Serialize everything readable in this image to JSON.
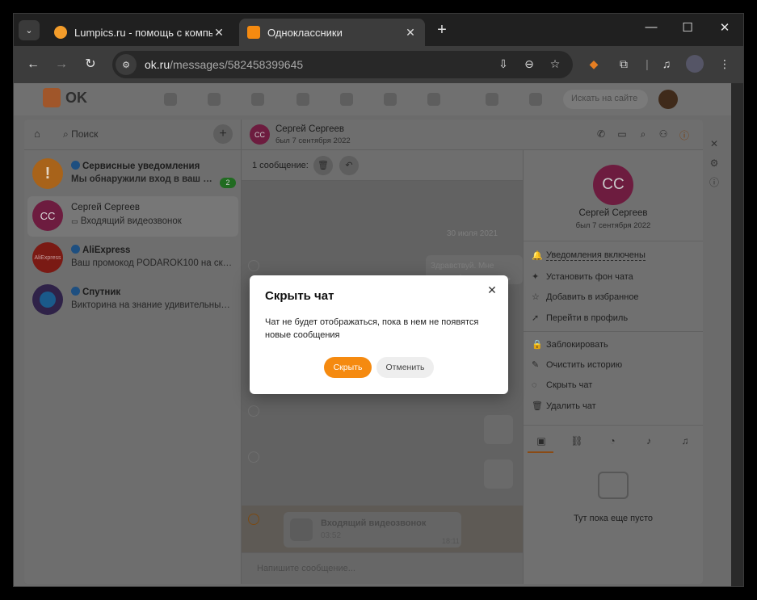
{
  "browser": {
    "tabs": [
      {
        "title": "Lumpics.ru - помощь с компьютером",
        "close": "✕",
        "favicon_color": "#f39c2a"
      },
      {
        "title": "Одноклассники",
        "close": "✕",
        "favicon_color": "#f58a10"
      }
    ],
    "new_tab": "+",
    "tab_menu": "⌄",
    "window_controls": {
      "minimize": "—",
      "maximize": "☐",
      "close": "✕"
    },
    "nav": {
      "back": "←",
      "forward": "→",
      "reload": "↻"
    },
    "url_host": "ok.ru",
    "url_path": "/messages/582458399645"
  },
  "ok": {
    "logo_text": "OK",
    "search_placeholder": "Искать на сайте"
  },
  "sidebar": {
    "home_icon": "⌂",
    "search_label": "Поиск",
    "add_icon": "+",
    "chats": [
      {
        "name": "Сервисные уведомления",
        "preview": "Мы обнаружили вход в ваш профиль",
        "unread": "2",
        "avatar_text": "!",
        "avatar_color": "#a8631a",
        "bold": true,
        "verified": true
      },
      {
        "name": "Сергей Сергеев",
        "preview": "Входящий видеозвонок",
        "preview_icon": "▭",
        "avatar_text": "СС",
        "avatar_color": "#6d1c3f",
        "bold": false,
        "verified": false,
        "selected": true
      },
      {
        "name": "AliExpress",
        "preview": "Ваш промокод PODAROK100 на скидку",
        "avatar_text": "AliExpress",
        "avatar_color": "#7a1a14",
        "bold": false,
        "verified": true
      },
      {
        "name": "Спутник",
        "preview": "Викторина на знание удивительных фактов",
        "avatar_text": "",
        "avatar_color": "#2f2248",
        "bold": false,
        "verified": true
      }
    ]
  },
  "chat": {
    "avatar_text": "СС",
    "name": "Сергей Сергеев",
    "status": "был 7 сентября 2022",
    "selection_text": "1 сообщение:",
    "date_chip": "30 июля 2021",
    "ghost_message": "Здравствуй. Мне нужны фото, отправь их мне, пожалуйста",
    "call_title": "Входящий видеозвонок",
    "call_duration": "03:52",
    "call_time": "18:11",
    "composer_placeholder": "Напишите сообщение..."
  },
  "info": {
    "avatar_text": "СС",
    "name": "Сергей Сергеев",
    "status": "был 7 сентября 2022",
    "items_group1": [
      {
        "icon": "🔔",
        "label": "Уведомления включены",
        "underline": true
      },
      {
        "icon": "✦",
        "label": "Установить фон чата"
      },
      {
        "icon": "☆",
        "label": "Добавить в избранное"
      },
      {
        "icon": "➚",
        "label": "Перейти в профиль"
      }
    ],
    "items_group2": [
      {
        "icon": "🔒",
        "label": "Заблокировать"
      },
      {
        "icon": "✎",
        "label": "Очистить историю"
      },
      {
        "icon": "◌",
        "label": "Скрыть чат"
      },
      {
        "icon": "🗑",
        "label": "Удалить чат"
      }
    ],
    "tabs": [
      "▣",
      "⛓",
      "◔",
      "♪",
      "♫"
    ],
    "empty_text": "Тут пока еще пусто"
  },
  "modal": {
    "title": "Скрыть чат",
    "close": "✕",
    "text": "Чат не будет отображаться, пока в нем не появятся новые сообщения",
    "confirm": "Скрыть",
    "cancel": "Отменить"
  },
  "colors": {
    "accent": "#f58a10",
    "avatar": "#c2185b"
  }
}
